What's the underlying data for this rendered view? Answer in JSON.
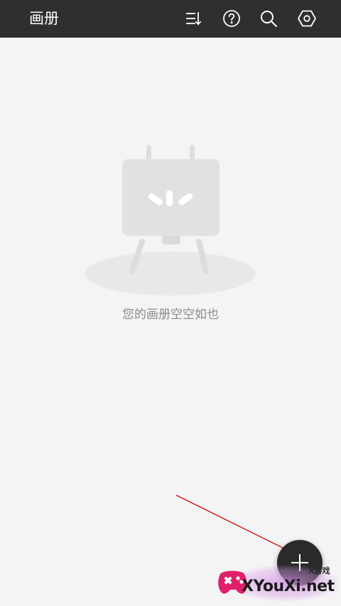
{
  "header": {
    "title": "画册",
    "icons": [
      "sort-list-icon",
      "help-icon",
      "search-icon",
      "settings-icon"
    ]
  },
  "empty_state": {
    "message": "您的画册空空如也"
  },
  "fab": {
    "icon": "plus-icon"
  },
  "watermark": {
    "tag": "X游戏",
    "domain": "XYouXi.net"
  },
  "colors": {
    "header_bg": "#2f2f2f",
    "page_bg": "#f4f4f4",
    "fab_bg": "#2a2a2a",
    "annotation_arrow": "#d01818",
    "watermark_accent": "#e0206a"
  }
}
